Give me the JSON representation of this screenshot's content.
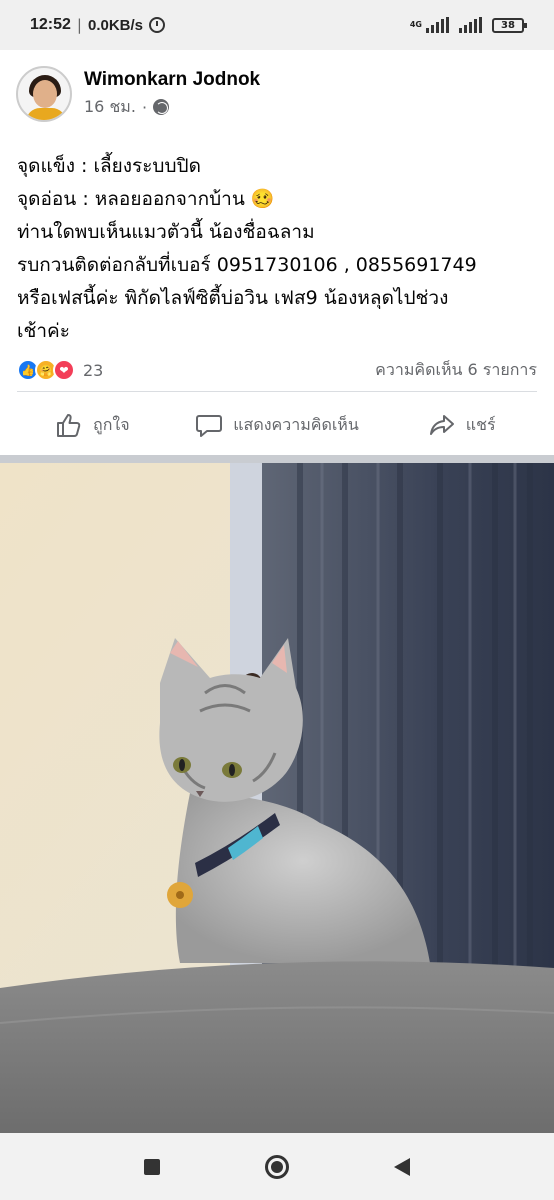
{
  "status_bar": {
    "time": "12:52",
    "speed": "0.0KB/s",
    "network": "4G",
    "battery": "38"
  },
  "post": {
    "author": "Wimonkarn Jodnok",
    "time": "16 ชม.",
    "dot": "·",
    "lines": [
      "จุดแข็ง : เลี้ยงระบบปิด",
      "จุดอ่อน : หลอยออกจากบ้าน 🥴",
      "ท่านใดพบเห็นแมวตัวนี้ น้องชื่อฉลาม",
      "รบกวนติดต่อกลับที่เบอร์ 0951730106 , 0855691749",
      "หรือเฟสนี้ค่ะ พิกัดไลฟ์ซิตี้บ่อวิน เฟส9 น้องหลุดไปช่วง",
      "เช้าค่ะ"
    ],
    "reaction_count": "23",
    "comment_count": "ความคิดเห็น 6 รายการ"
  },
  "actions": {
    "like": "ถูกใจ",
    "comment": "แสดงความคิดเห็น",
    "share": "แชร์"
  },
  "colors": {
    "facebook_blue": "#1877f2",
    "secondary_text": "#65676b"
  }
}
